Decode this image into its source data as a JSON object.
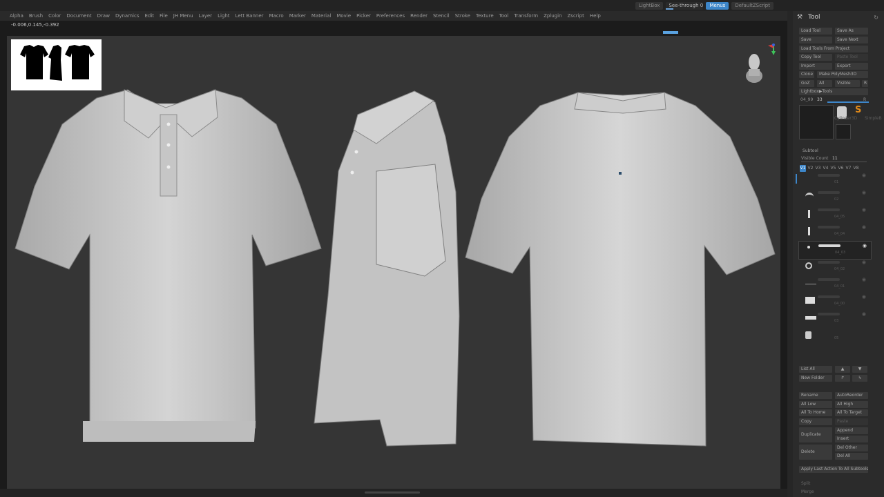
{
  "topbar": {
    "lightbox_label": "LightBox",
    "see_through_label": "See-through",
    "see_through_value": "0",
    "menus_label": "Menus",
    "default_script_label": "DefaultZScript"
  },
  "menubar": {
    "items": [
      "Alpha",
      "Brush",
      "Color",
      "Document",
      "Draw",
      "Dynamics",
      "Edit",
      "File",
      "JH Menu",
      "Layer",
      "Light",
      "Lett Banner",
      "Macro",
      "Marker",
      "Material",
      "Movie",
      "Picker",
      "Preferences",
      "Render",
      "Stencil",
      "Stroke",
      "Texture",
      "Tool",
      "Transform",
      "Zplugin",
      "Zscript",
      "Help"
    ]
  },
  "canvas": {
    "coordinates": "-0.006,0.145,-0.392"
  },
  "panel": {
    "title": "Tool",
    "load_tool": "Load Tool",
    "save_as": "Save As",
    "save": "Save",
    "save_next": "Save Next",
    "load_tools_from_project": "Load Tools From Project",
    "copy_tool": "Copy Tool",
    "paste_tool": "Paste Tool",
    "import": "Import",
    "export": "Export",
    "clone": "Clone",
    "make_polymesh3d": "Make PolyMesh3D",
    "goz": "GoZ",
    "all": "All",
    "visible": "Visible",
    "r": "R",
    "lightbox_tools": "Lightbox▶Tools",
    "tool_name": "04_99",
    "tool_value": "33",
    "tool_r": "R",
    "cylinder_label": "Cylinder3D",
    "simplebrush_label": "SimpleB",
    "subtool_header": "Subtool",
    "visible_count_label": "Visible Count",
    "visible_count_value": "11",
    "v_tabs": [
      "V1",
      "V2",
      "V3",
      "V4",
      "V5",
      "V6",
      "V7",
      "V8"
    ],
    "subtools": [
      "01",
      "02",
      "04_05",
      "04_04",
      "04_03",
      "04_02",
      "04_01",
      "04_00",
      "03",
      "05"
    ],
    "list_all": "List All",
    "new_folder": "New Folder",
    "rename": "Rename",
    "autoreorder": "AutoReorder",
    "all_low": "All Low",
    "all_high": "All High",
    "all_to_home": "All To Home",
    "all_to_target": "All To Target",
    "copy": "Copy",
    "paste": "Paste",
    "duplicate": "Duplicate",
    "append": "Append",
    "insert": "Insert",
    "delete": "Delete",
    "del_other": "Del Other",
    "del_all": "Del All",
    "apply_last_action": "Apply Last Action To All Subtools",
    "split": "Split",
    "merge": "Merge"
  },
  "colors": {
    "accent": "#3d86c9",
    "viewport_bg": "#353535",
    "shirt": "#c9c9c9"
  }
}
